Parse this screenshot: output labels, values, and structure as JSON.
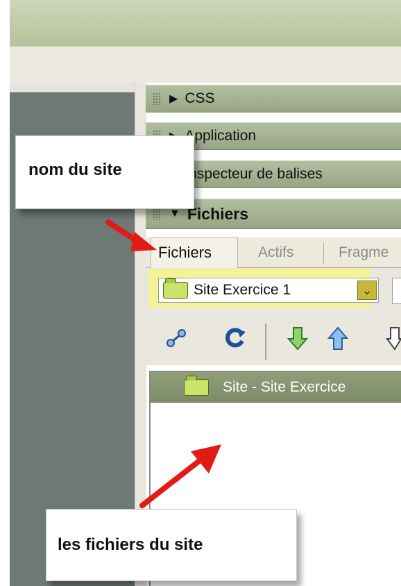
{
  "panels": {
    "css": "CSS",
    "application": "Application",
    "inspector": "Inspecteur de balises",
    "files": "Fichiers"
  },
  "tabs": [
    "Fichiers",
    "Actifs",
    "Fragme"
  ],
  "site_selector": {
    "value": "Site Exercice 1"
  },
  "file_tree": {
    "root": "Site - Site Exercice"
  },
  "annotations": {
    "site_name": "nom du site",
    "site_files": "les fichiers du site"
  },
  "icons": {
    "connect": "connect-icon",
    "refresh": "refresh-icon",
    "get": "get-arrow-icon",
    "put": "put-arrow-icon",
    "checkout": "checkout-icon"
  },
  "colors": {
    "highlight": "#f6f294",
    "arrow": "#e31b17",
    "panel": "#a8b494"
  }
}
